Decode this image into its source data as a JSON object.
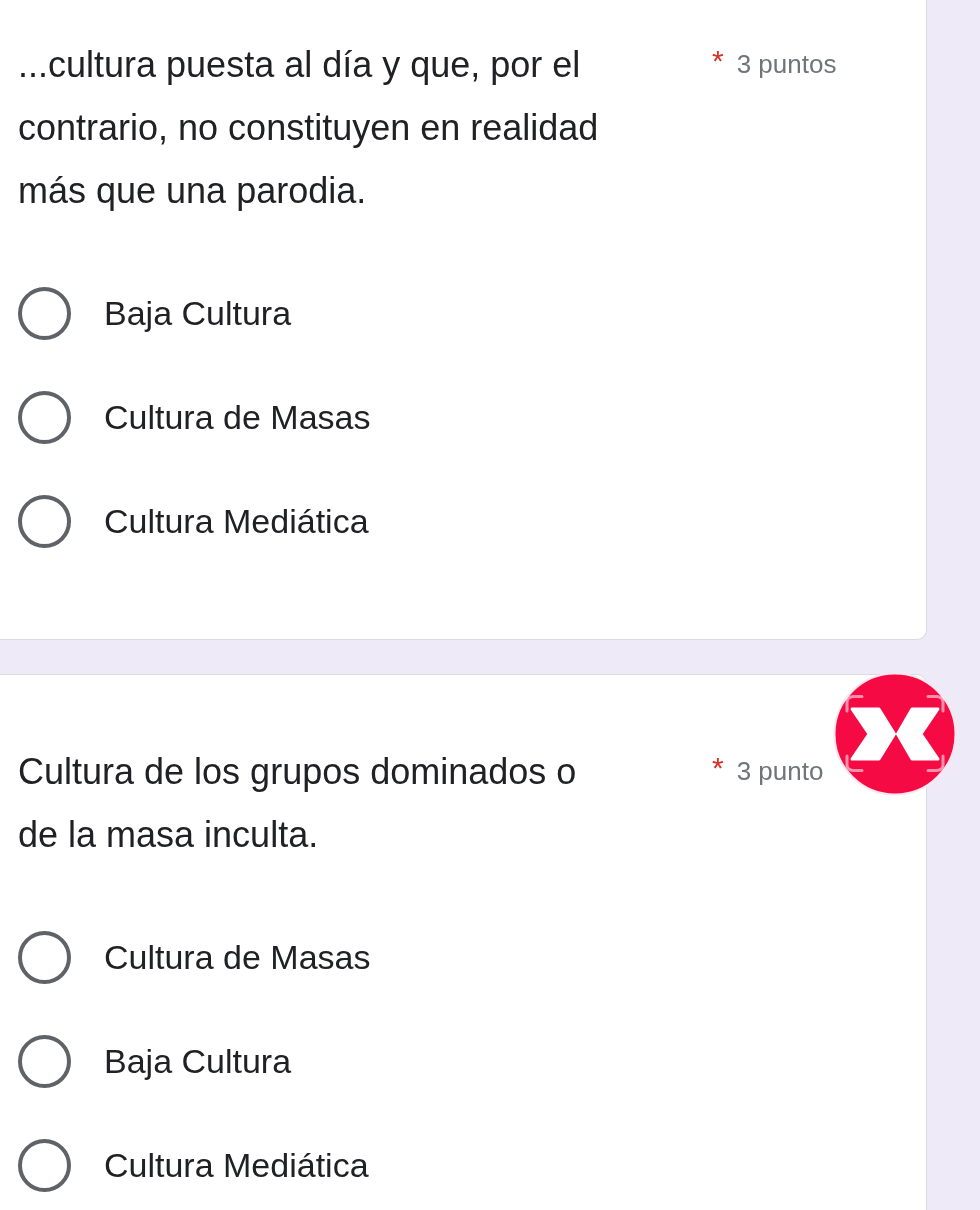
{
  "questions": [
    {
      "text": "...cultura puesta al día y que, por el\ncontrario, no constituyen en realidad\nmás que una parodia.",
      "required_mark": "*",
      "points": "3 puntos",
      "options": [
        {
          "label": "Baja Cultura",
          "selected": false
        },
        {
          "label": "Cultura de Masas",
          "selected": false
        },
        {
          "label": "Cultura Mediática",
          "selected": false
        }
      ]
    },
    {
      "text": "Cultura de los grupos dominados o\nde la masa inculta.",
      "required_mark": "*",
      "points": "3 punto",
      "options": [
        {
          "label": "Cultura de Masas",
          "selected": false
        },
        {
          "label": "Baja Cultura",
          "selected": false
        },
        {
          "label": "Cultura Mediática",
          "selected": false
        }
      ]
    }
  ]
}
